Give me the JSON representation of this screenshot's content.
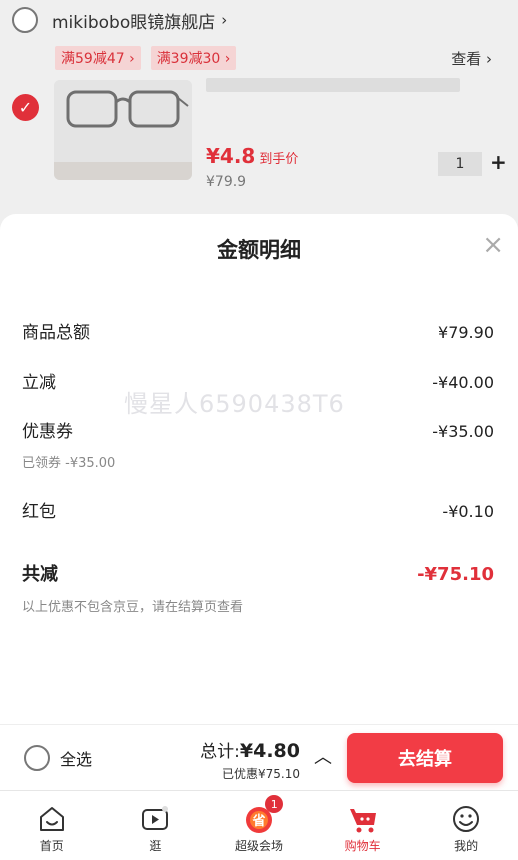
{
  "cart": {
    "store_name": "mikibobo眼镜旗舰店",
    "store_arrow": "›",
    "promos": [
      "满59减47 ›",
      "满39减30 ›"
    ],
    "check_more": "查看 ›",
    "item": {
      "price_symbol": "¥",
      "price": "4.8",
      "price_suffix": "到手价",
      "original_price": "¥79.9",
      "quantity": "1",
      "plus": "+"
    }
  },
  "sheet": {
    "title": "金额明细",
    "close": "×",
    "rows": [
      {
        "label": "商品总额",
        "value": "¥79.90"
      },
      {
        "label": "立减",
        "value": "-¥40.00"
      },
      {
        "label": "优惠券",
        "value": "-¥35.00",
        "sub": "已领券 -¥35.00"
      },
      {
        "label": "红包",
        "value": "-¥0.10"
      }
    ],
    "total": {
      "label": "共减",
      "value": "-¥75.10"
    },
    "note": "以上优惠不包含京豆，请在结算页查看",
    "watermark": "慢星人6590438T6"
  },
  "checkout": {
    "select_all": "全选",
    "total_prefix": "总计:",
    "total_value": "¥4.80",
    "saved": "已优惠¥75.10",
    "caret": "︿",
    "button": "去结算"
  },
  "tabs": [
    {
      "label": "首页",
      "icon": "home-icon"
    },
    {
      "label": "逛",
      "icon": "video-icon"
    },
    {
      "label": "超级会场",
      "icon": "super-venue-icon",
      "badge": "1"
    },
    {
      "label": "购物车",
      "icon": "cart-icon",
      "active": true
    },
    {
      "label": "我的",
      "icon": "profile-icon"
    }
  ],
  "colors": {
    "accent": "#e0303a",
    "button": "#f23c45"
  }
}
